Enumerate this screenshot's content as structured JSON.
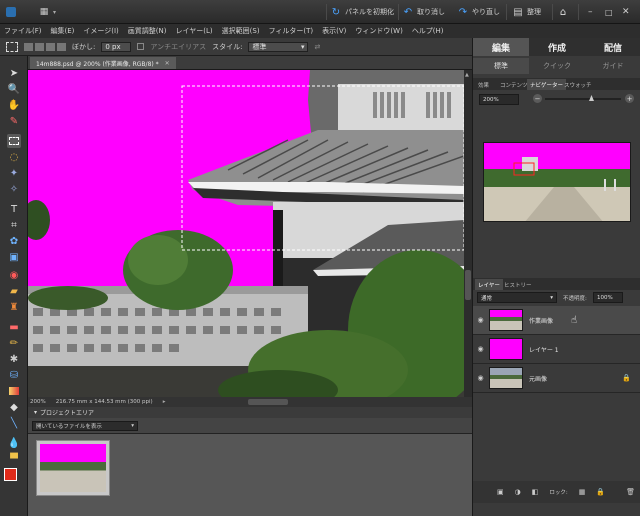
{
  "topbar": {
    "reset_panels": "パネルを初期化",
    "undo": "取り消し",
    "redo": "やり直し",
    "organize": "整理"
  },
  "menu": [
    "ファイル(F)",
    "編集(E)",
    "イメージ(I)",
    "画質調整(N)",
    "レイヤー(L)",
    "選択範囲(S)",
    "フィルター(T)",
    "表示(V)",
    "ウィンドウ(W)",
    "ヘルプ(H)"
  ],
  "options": {
    "feather_label": "ぼかし:",
    "feather_value": "0 px",
    "antialias_label": "アンチエイリアス",
    "style_label": "スタイル:",
    "style_value": "標準"
  },
  "document": {
    "tab_title": "14m888.psd @ 200% (作業画像, RGB/8) *",
    "zoom": "200%",
    "info": "216.75 mm x 144.53 mm (300 ppi)"
  },
  "project_bin": {
    "title": "プロジェクトエリア",
    "dropdown": "開いているファイルを表示"
  },
  "right_panel": {
    "tabs": [
      "編集",
      "作成",
      "配信"
    ],
    "subtabs": [
      "標準",
      "クイック",
      "ガイド"
    ],
    "palette_tabs": [
      "効果",
      "コンテンツ",
      "ナビゲーター",
      "スウォッチ"
    ],
    "nav_zoom": "200%",
    "layer_tabs": [
      "レイヤー",
      "ヒストリー"
    ],
    "blend_mode": "通常",
    "opacity_label": "不透明度:",
    "opacity_value": "100%",
    "layers": [
      "作業画像",
      "レイヤー 1",
      "元画像"
    ],
    "lock_label": "ロック:"
  },
  "colors": {
    "magenta": "#ff00ff",
    "selected_layer": "#4a4a4a",
    "accent_blue": "#4aa3ff"
  }
}
